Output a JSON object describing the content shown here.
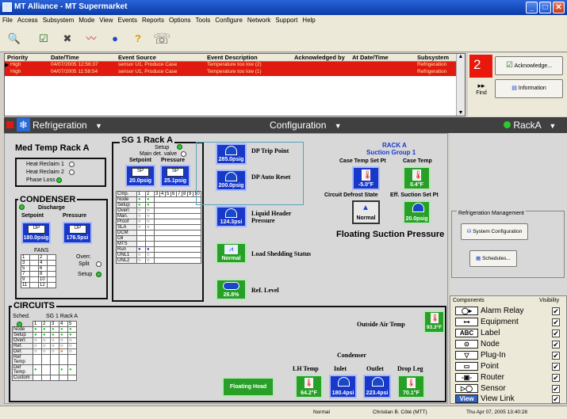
{
  "window": {
    "title": "MT Alliance - MT Supermarket",
    "min": "_",
    "max": "□",
    "close": "✕"
  },
  "menu": [
    "File",
    "Access",
    "Subsystem",
    "Mode",
    "View",
    "Events",
    "Reports",
    "Options",
    "Tools",
    "Configure",
    "Network",
    "Support",
    "Help"
  ],
  "toolbar": {
    "icons": [
      "key-icon",
      "acknowledge-icon",
      "tools-icon",
      "chart-icon",
      "globe-icon",
      "help-icon",
      "phone-icon"
    ],
    "glyphs": [
      "🔍",
      "☑",
      "✖",
      "〰",
      "●",
      "?",
      "☏"
    ]
  },
  "alarms": {
    "headers": {
      "priority": "Priority",
      "datetime": "Date/Time",
      "source": "Event Source",
      "description": "Event Description",
      "ackby": "Acknowledged by",
      "ackdate": "At Date/Time",
      "subsystem": "Subsystem"
    },
    "rows": [
      {
        "priority": "High",
        "datetime": "04/07/2005 12:56:37",
        "source": "sensor U1, Produce Case",
        "description": "Temperature too low (2)",
        "ackby": "",
        "ackdate": "",
        "subsystem": "Refrigeration"
      },
      {
        "priority": "High",
        "datetime": "04/07/2005 11:58:54",
        "source": "sensor U1, Produce Case",
        "description": "Temperature too low (1)",
        "ackby": "",
        "ackdate": "",
        "subsystem": "Refrigeration"
      }
    ],
    "count": "2",
    "acknowledge": "Acknowledge...",
    "information": "Information",
    "find": "Find"
  },
  "nav": {
    "subsystem": "Refrigeration",
    "view": "Configuration",
    "rack": "RackA",
    "arrow": "▼"
  },
  "medtemp": {
    "title": "Med Temp Rack A",
    "items": [
      "Heat Reclaim 1",
      "Heat Reclaim 2",
      "Phase Loss"
    ]
  },
  "condenser": {
    "title": "CONDENSER",
    "discharge": "Discharge",
    "setpoint": "Setpoint",
    "pressure": "Pressure",
    "dp": "DP",
    "sp_value": "180.0psig",
    "pr_value": "176.5psi",
    "fans": "FANS",
    "over": "Overr.",
    "split": "Split",
    "setup": "Setup",
    "fan_nums": [
      "1",
      "2",
      "3",
      "4",
      "5",
      "6",
      "7",
      "8",
      "9",
      "10",
      "11",
      "12"
    ]
  },
  "sg1": {
    "title": "SG 1 Rack A",
    "setup": "Setup",
    "main_valve": "Main det. valve",
    "setpoint": "Setpoint",
    "pressure": "Pressure",
    "sp": "SP",
    "sp_value": "20.0psig",
    "pr_value": "25.1psig",
    "cols": [
      "Cmp.",
      "1",
      "2",
      "3",
      "4",
      "5",
      "6",
      "7",
      "8",
      "9",
      "10"
    ],
    "rows": [
      "Node",
      "Setup",
      "Overr.",
      "Man.",
      "Proof",
      "SLA",
      "DCM",
      "Oil",
      "MTS",
      "Run",
      "UNL1",
      "UNL2"
    ]
  },
  "dp": {
    "trip_label": "DP Trip Point",
    "trip_value": "285.0psig",
    "reset_label": "DP Auto Reset",
    "reset_value": "200.0psig"
  },
  "liquid": {
    "label": "Liquid Header Pressure",
    "value": "124.3psi"
  },
  "loadshed": {
    "label": "Load Shedding Status",
    "value": "Normal"
  },
  "reflevel": {
    "label": "Ref. Level",
    "value": "26.8%"
  },
  "racka": {
    "title": "RACK A",
    "group": "Suction Group 1",
    "case_sp": "Case Temp Set Pt",
    "case_temp": "Case Temp",
    "case_sp_value": "-5.0°F",
    "case_temp_value": "0.4°F",
    "defrost": "Circuit Defrost State",
    "eff_sp": "Eff. Suction Set Pt",
    "defrost_value": "Normal",
    "eff_value": "20.0psig",
    "floating": "Floating Suction Pressure"
  },
  "circuits": {
    "title": "CIRCUITS",
    "sched": "Sched.",
    "rack": "SG 1 Rack A",
    "cols": [
      "1",
      "2",
      "3",
      "4",
      "5"
    ],
    "rows": [
      "Node",
      "Setup",
      "Overr.",
      "Ref.",
      "Def.",
      "Ref Temp",
      "Def Temp",
      "Custom"
    ]
  },
  "outside": {
    "label": "Outside Air Temp",
    "value": "93.3°F"
  },
  "condenser2": {
    "title": "Condenser",
    "lh": "LH Temp",
    "inlet": "Inlet",
    "outlet": "Outlet",
    "dropleg": "Drop Leg",
    "lh_value": "64.2°F",
    "inlet_value": "180.4psi",
    "outlet_value": "223.4psi",
    "drop_value": "70.1°F",
    "floating_head": "Floating Head"
  },
  "mgmt": {
    "title": "Refrigeration Management",
    "system": "System Configuration",
    "schedules": "Schedules..."
  },
  "components": {
    "title": "Components",
    "visibility": "Visibility",
    "items": [
      {
        "name": "Alarm Relay",
        "icon": "◯▸"
      },
      {
        "name": "Equipment",
        "icon": "⊶"
      },
      {
        "name": "Label",
        "icon": "ABC"
      },
      {
        "name": "Node",
        "icon": "⊙"
      },
      {
        "name": "Plug-In",
        "icon": "▽"
      },
      {
        "name": "Point",
        "icon": "▭"
      },
      {
        "name": "Router",
        "icon": "-▣-"
      },
      {
        "name": "Sensor",
        "icon": "▷◯"
      },
      {
        "name": "View Link",
        "icon": "View"
      }
    ],
    "check": "✔"
  },
  "status": {
    "mode": "Normal",
    "user": "Christian B. Côté (MTT)",
    "datetime": "Thu Apr 07, 2005  13:40:28"
  }
}
